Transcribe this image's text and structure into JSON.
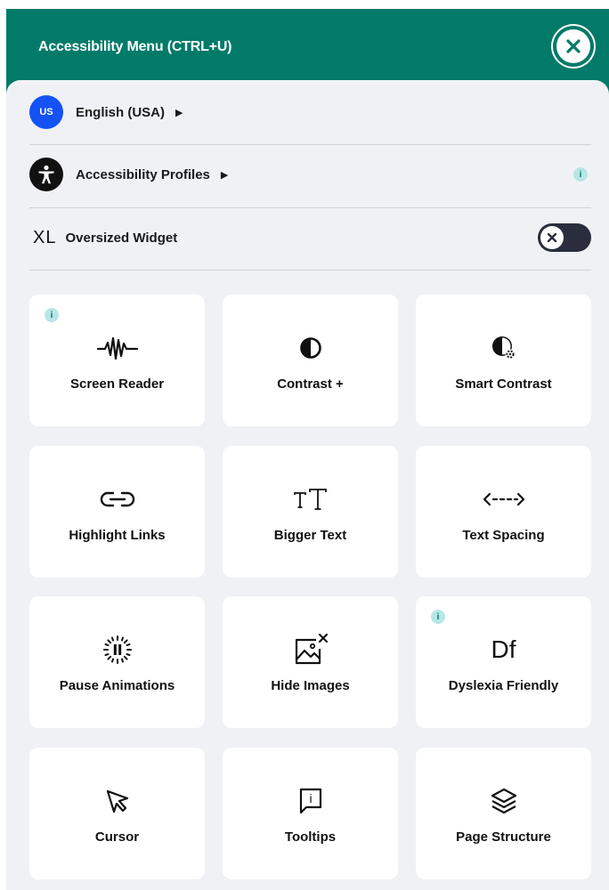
{
  "header": {
    "title": "Accessibility Menu (CTRL+U)",
    "close_icon": "close-icon"
  },
  "language": {
    "badge": "US",
    "label": "English (USA)"
  },
  "profiles": {
    "label": "Accessibility Profiles",
    "info": "i"
  },
  "oversized": {
    "prefix": "XL",
    "label": "Oversized Widget",
    "toggle_state": "off"
  },
  "tiles": [
    {
      "label": "Screen Reader",
      "icon": "waveform-icon",
      "info": "i"
    },
    {
      "label": "Contrast +",
      "icon": "contrast-icon"
    },
    {
      "label": "Smart Contrast",
      "icon": "smart-contrast-icon"
    },
    {
      "label": "Highlight Links",
      "icon": "link-icon"
    },
    {
      "label": "Bigger Text",
      "icon": "text-size-icon"
    },
    {
      "label": "Text Spacing",
      "icon": "text-spacing-icon"
    },
    {
      "label": "Pause Animations",
      "icon": "pause-icon"
    },
    {
      "label": "Hide Images",
      "icon": "hide-image-icon"
    },
    {
      "label": "Dyslexia Friendly",
      "icon": "dyslexia-icon",
      "info": "i",
      "glyph": "Df"
    },
    {
      "label": "Cursor",
      "icon": "cursor-icon"
    },
    {
      "label": "Tooltips",
      "icon": "tooltip-icon",
      "glyph": "i"
    },
    {
      "label": "Page Structure",
      "icon": "layers-icon"
    }
  ],
  "colors": {
    "header": "#017a69",
    "panel": "#eff1f5",
    "badge": "#1452f5",
    "info": "#b8e5e5",
    "toggle": "#2a2d3e"
  }
}
